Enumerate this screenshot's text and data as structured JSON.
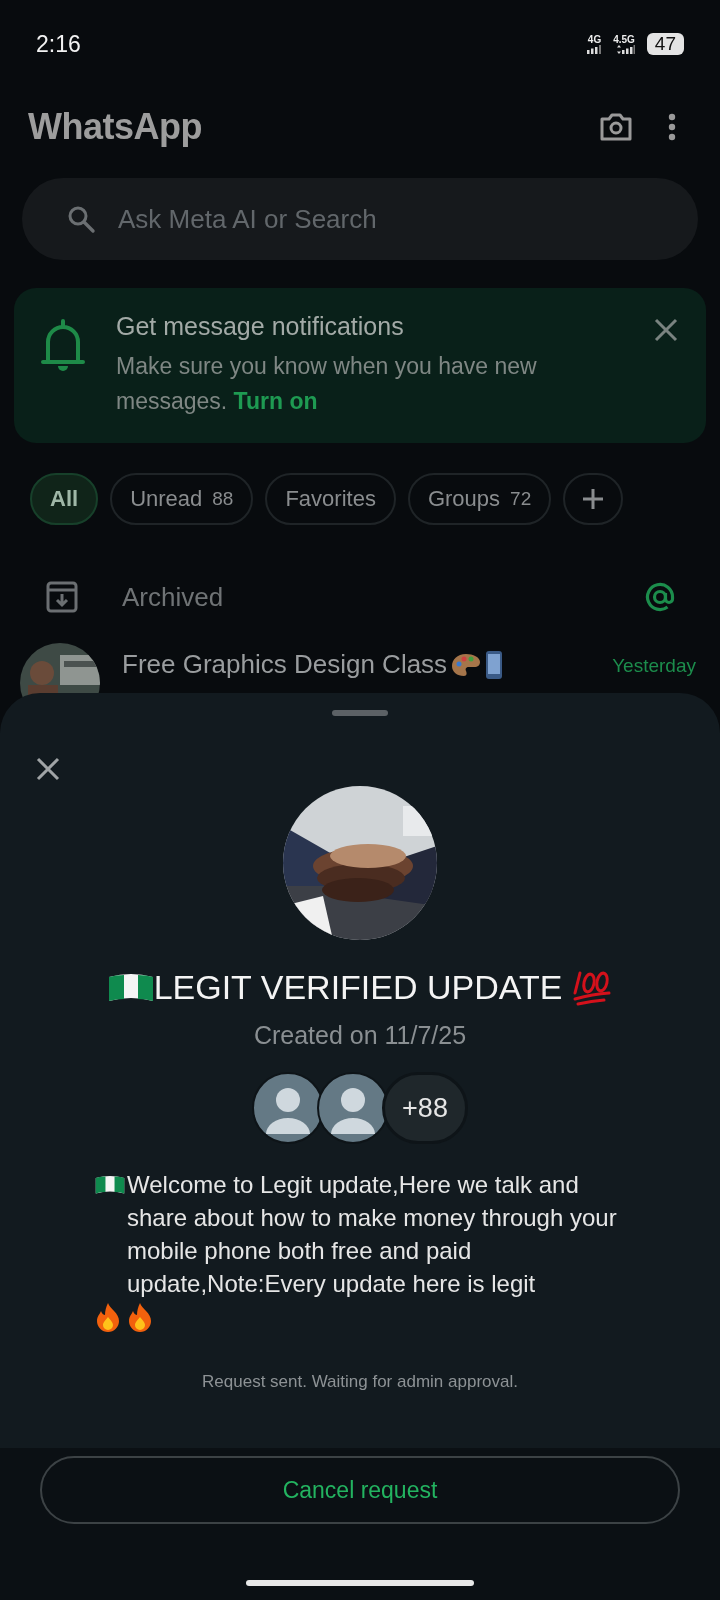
{
  "status_bar": {
    "time": "2:16",
    "network_1": "4G",
    "network_2": "4.5G",
    "battery": "47"
  },
  "header": {
    "title": "WhatsApp"
  },
  "search": {
    "placeholder": "Ask Meta AI or Search"
  },
  "banner": {
    "title": "Get message notifications",
    "text": "Make sure you know when you have new messages.",
    "action": "Turn on"
  },
  "filters": [
    {
      "label": "All",
      "selected": true
    },
    {
      "label": "Unread",
      "count": "88",
      "selected": false
    },
    {
      "label": "Favorites",
      "selected": false
    },
    {
      "label": "Groups",
      "count": "72",
      "selected": false
    }
  ],
  "archived": {
    "label": "Archived"
  },
  "chat": {
    "name": "Free Graphics Design Class",
    "time": "Yesterday"
  },
  "sheet": {
    "title": "LEGIT VERIFIED UPDATE",
    "created": "Created on 11/7/25",
    "members_more": "+88",
    "description": "Welcome to Legit update,Here we talk and share about how to make money through your mobile phone both free and paid update,Note:Every update here is legit",
    "status": "Request sent. Waiting for admin approval.",
    "button": "Cancel request"
  }
}
